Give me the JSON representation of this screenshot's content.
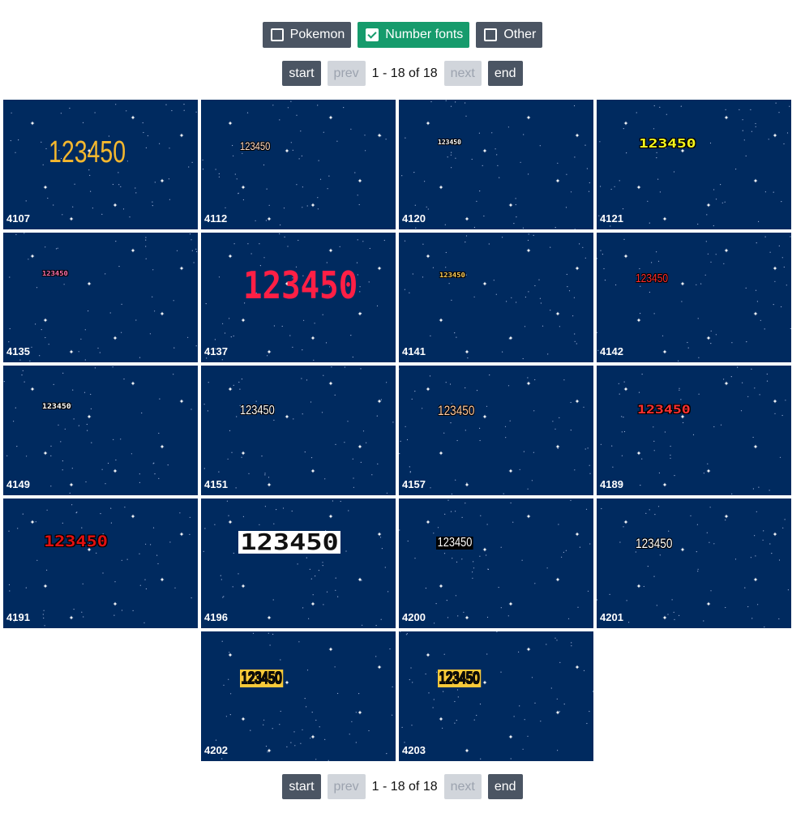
{
  "filters": [
    {
      "label": "Pokemon",
      "checked": false
    },
    {
      "label": "Number fonts",
      "checked": true
    },
    {
      "label": "Other",
      "checked": false
    }
  ],
  "pagination": {
    "start": "start",
    "prev": "prev",
    "range": "1 - 18 of 18",
    "next": "next",
    "end": "end"
  },
  "sample_text": "123450",
  "tiles": [
    {
      "id": "4107",
      "color": "#f5b82e"
    },
    {
      "id": "4112",
      "color": "#ffd9c2"
    },
    {
      "id": "4120",
      "color": "#ffffff"
    },
    {
      "id": "4121",
      "color": "#f4f51c"
    },
    {
      "id": "4135",
      "color": "#ff6fa8"
    },
    {
      "id": "4137",
      "color": "#ff1f45"
    },
    {
      "id": "4141",
      "color": "#ffcc55"
    },
    {
      "id": "4142",
      "color": "#ff2a2a"
    },
    {
      "id": "4149",
      "color": "#ffffff"
    },
    {
      "id": "4151",
      "color": "#ffffff"
    },
    {
      "id": "4157",
      "color": "#ffc9a0"
    },
    {
      "id": "4189",
      "color": "#ff3030"
    },
    {
      "id": "4191",
      "color": "#e01010"
    },
    {
      "id": "4196",
      "color": "#111111"
    },
    {
      "id": "4200",
      "color": "#ffffff"
    },
    {
      "id": "4201",
      "color": "#ffffff"
    },
    {
      "id": "4202",
      "color": "#f8c93a"
    },
    {
      "id": "4203",
      "color": "#f8c93a"
    }
  ]
}
